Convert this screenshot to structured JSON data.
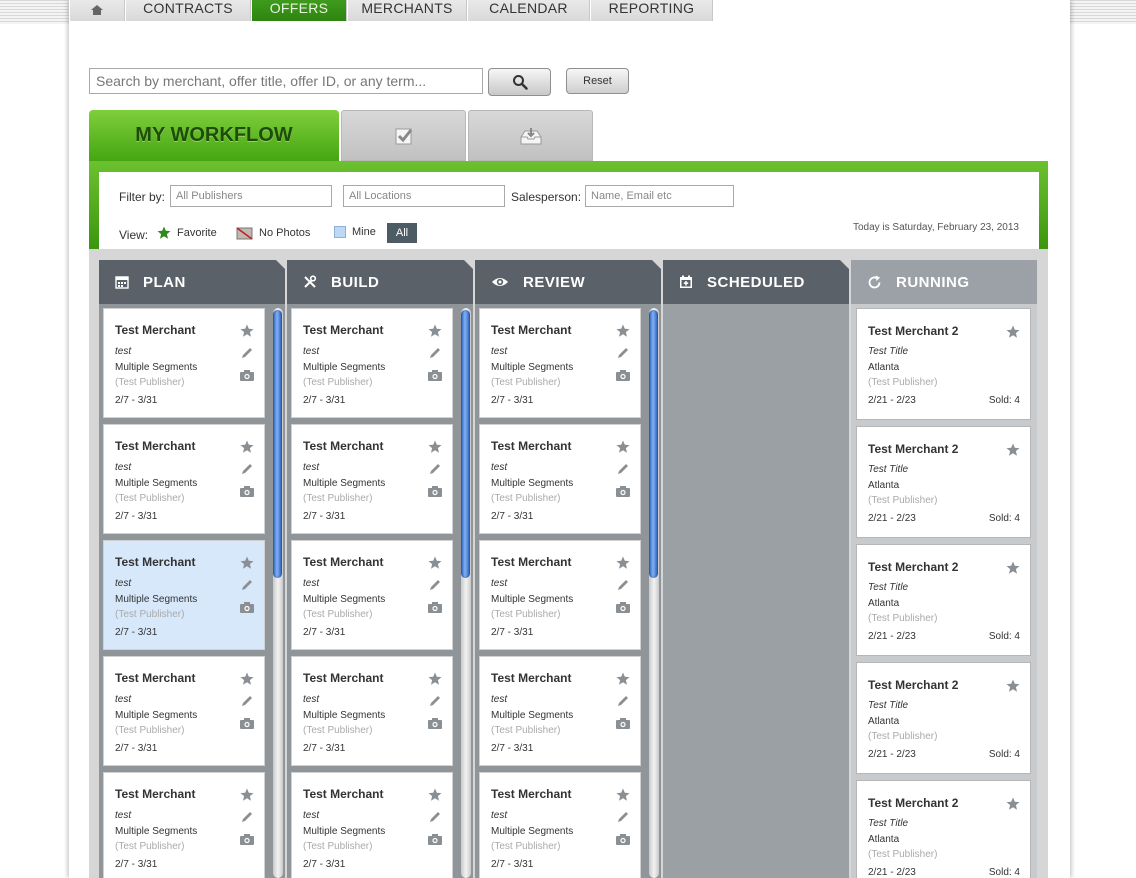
{
  "nav": {
    "tabs": [
      {
        "label": "CONTRACTS"
      },
      {
        "label": "OFFERS"
      },
      {
        "label": "MERCHANTS"
      },
      {
        "label": "CALENDAR"
      },
      {
        "label": "REPORTING"
      }
    ],
    "active": "OFFERS"
  },
  "search": {
    "placeholder": "Search by merchant, offer title, offer ID, or any term...",
    "reset_label": "Reset"
  },
  "workflow_tabs": {
    "main_label": "MY WORKFLOW",
    "approved_icon": "checkbox-icon",
    "inbox_icon": "inbox-icon"
  },
  "filters": {
    "filter_by_label": "Filter by:",
    "publishers_placeholder": "All Publishers",
    "locations_placeholder": "All Locations",
    "salesperson_label": "Salesperson:",
    "salesperson_placeholder": "Name, Email etc",
    "view_label": "View:",
    "favorite_label": "Favorite",
    "no_photos_label": "No Photos",
    "mine_label": "Mine",
    "all_label": "All",
    "today_text": "Today is Saturday, February 23, 2013"
  },
  "columns": [
    {
      "title": "PLAN",
      "icon": "calendar-icon"
    },
    {
      "title": "BUILD",
      "icon": "tools-icon"
    },
    {
      "title": "REVIEW",
      "icon": "eye-icon"
    },
    {
      "title": "SCHEDULED",
      "icon": "calendar-plus-icon"
    },
    {
      "title": "RUNNING",
      "icon": "refresh-icon"
    }
  ],
  "card": {
    "merchant": "Test Merchant",
    "title": "test",
    "segments": "Multiple Segments",
    "publisher": "(Test Publisher)",
    "dates": "2/7 - 3/31"
  },
  "running_card": {
    "merchant": "Test Merchant 2",
    "title": "Test Title",
    "location": "Atlanta",
    "publisher": "(Test Publisher)",
    "dates": "2/21 - 2/23",
    "sold": "Sold: 4"
  },
  "colors": {
    "accent_green": "#45a512",
    "column_header": "#5a6168",
    "selected_card": "#d7e8fb"
  }
}
